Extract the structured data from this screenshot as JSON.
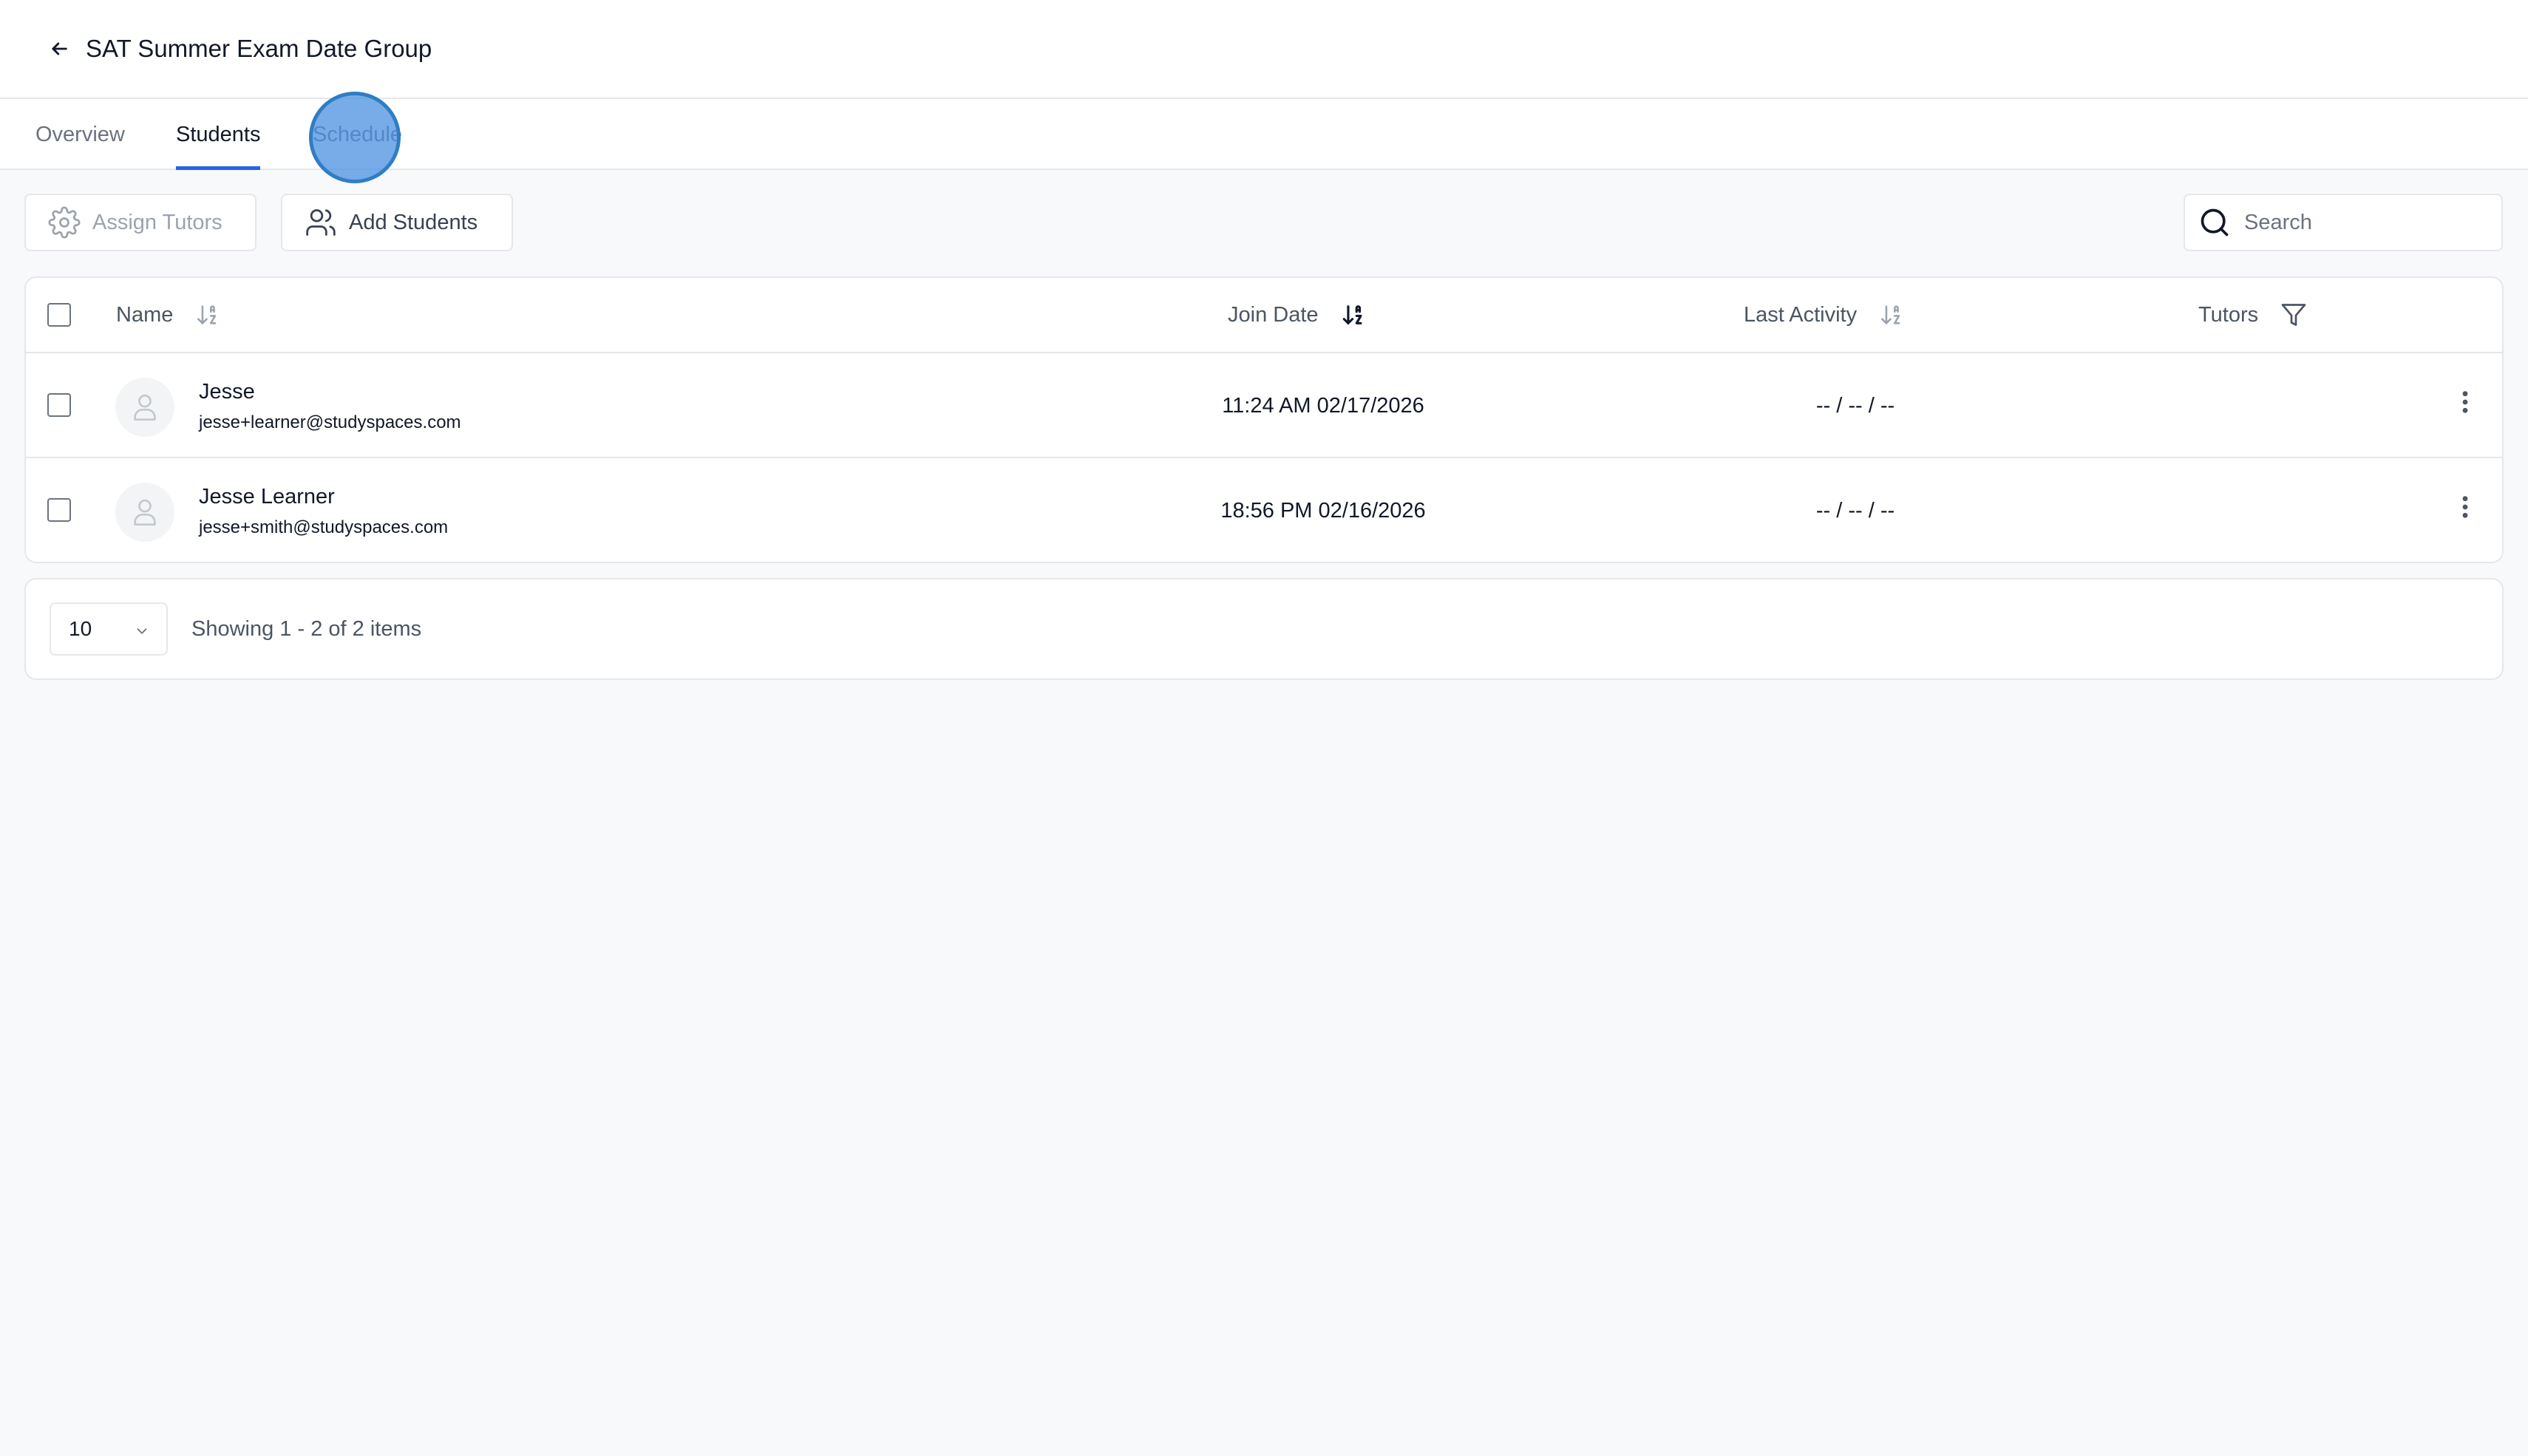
{
  "header": {
    "title": "SAT Summer Exam Date Group",
    "back_icon": "arrow-left-icon"
  },
  "tabs": [
    {
      "label": "Overview",
      "active": false
    },
    {
      "label": "Students",
      "active": true
    },
    {
      "label": "Schedule",
      "active": false
    }
  ],
  "toolbar": {
    "assign_tutors_label": "Assign Tutors",
    "assign_tutors_icon": "gear-icon",
    "add_students_label": "Add Students",
    "add_students_icon": "users-icon",
    "search_placeholder": "Search"
  },
  "table": {
    "columns": {
      "name": "Name",
      "join_date": "Join Date",
      "last_activity": "Last Activity",
      "tutors": "Tutors"
    },
    "rows": [
      {
        "name": "Jesse",
        "email": "jesse+learner@studyspaces.com",
        "join_date": "11:24 AM 02/17/2026",
        "last_activity": "-- / -- / --",
        "tutors": ""
      },
      {
        "name": "Jesse Learner",
        "email": "jesse+smith@studyspaces.com",
        "join_date": "18:56 PM 02/16/2026",
        "last_activity": "-- / -- / --",
        "tutors": ""
      }
    ]
  },
  "pagination": {
    "page_size": "10",
    "summary": "Showing 1 - 2 of 2 items"
  },
  "colors": {
    "accent": "#2563eb",
    "border": "#e5e7eb",
    "background": "#f8f9fa"
  }
}
